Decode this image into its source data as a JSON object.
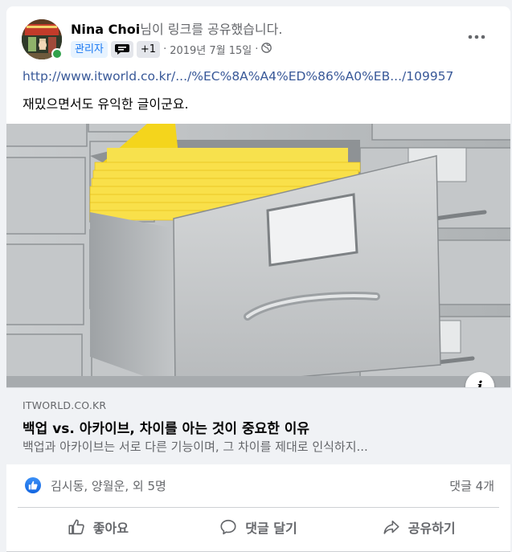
{
  "post": {
    "author": {
      "name": "Nina Choi",
      "action_text": "님이 링크를 공유했습니다.",
      "avatar_icon": "avatar-photo",
      "online": true
    },
    "meta": {
      "admin_badge": "관리자",
      "badge_icon": "chat-badge-icon",
      "plus_badge": "+1",
      "separator": "·",
      "date": "2019년 7월 15일",
      "separator2": "·",
      "privacy_icon": "globe-icon"
    },
    "more_icon": "more-options-icon",
    "link_url": "http://www.itworld.co.kr/.../%EC%8A%A4%ED%86%A0%EB.../109957",
    "message": "재밌으면서도 유익한 글이군요.",
    "preview": {
      "image_description_icon": "file-cabinet-image",
      "info_icon": "info-icon",
      "info_glyph": "i",
      "site": "ITWORLD.CO.KR",
      "title": "백업 vs. 아카이브, 차이를 아는 것이 중요한 이유",
      "description": "백업과 아카이브는 서로 다른 기능이며, 그 차이를 제대로 인식하지..."
    },
    "reactions": {
      "like_icon": "like-reaction-icon",
      "reactors": "김시동, 양월운, 외 5명",
      "comments": "댓글 4개"
    },
    "actions": [
      {
        "label": "좋아요",
        "icon": "thumbs-up-icon"
      },
      {
        "label": "댓글 달기",
        "icon": "comment-icon"
      },
      {
        "label": "공유하기",
        "icon": "share-icon"
      }
    ],
    "colors": {
      "link": "#385898",
      "accent": "#1877f2",
      "online": "#31a24c",
      "folder": "#f4d51c"
    }
  }
}
